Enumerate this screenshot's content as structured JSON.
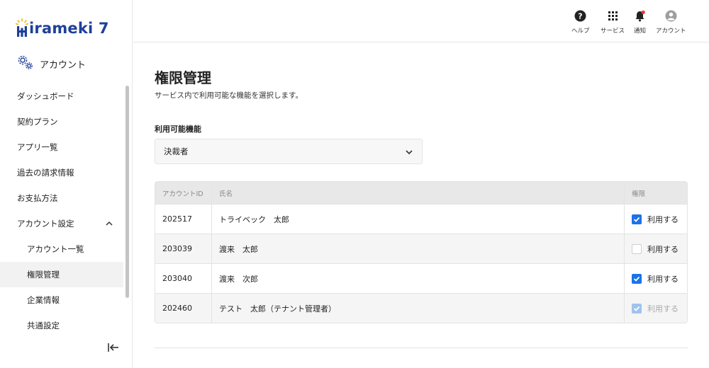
{
  "brand": {
    "logo_text": "irameki 7"
  },
  "sidebar": {
    "section_label": "アカウント",
    "items": [
      {
        "label": "ダッシュボード"
      },
      {
        "label": "契約プラン"
      },
      {
        "label": "アプリ一覧"
      },
      {
        "label": "過去の請求情報"
      },
      {
        "label": "お支払方法"
      },
      {
        "label": "アカウント設定"
      },
      {
        "label": "アカウント一覧"
      },
      {
        "label": "権限管理"
      },
      {
        "label": "企業情報"
      },
      {
        "label": "共通設定"
      }
    ]
  },
  "header": {
    "help_label": "ヘルプ",
    "services_label": "サービス",
    "notifications_label": "通知",
    "account_label": "アカウント"
  },
  "main": {
    "title": "権限管理",
    "description": "サービス内で利用可能な機能を選択します。",
    "feature_label": "利用可能機能",
    "feature_selected": "決裁者",
    "table": {
      "columns": [
        "アカウントID",
        "氏名",
        "権限"
      ],
      "rows": [
        {
          "id": "202517",
          "name": "トライベック　太郎",
          "permission": "利用する",
          "checked": true,
          "disabled": false
        },
        {
          "id": "203039",
          "name": "渡来　太郎",
          "permission": "利用する",
          "checked": false,
          "disabled": false
        },
        {
          "id": "203040",
          "name": "渡来　次郎",
          "permission": "利用する",
          "checked": true,
          "disabled": false
        },
        {
          "id": "202460",
          "name": "テスト　太郎（テナント管理者）",
          "permission": "利用する",
          "checked": true,
          "disabled": true
        }
      ]
    }
  },
  "colors": {
    "brand": "#1f3f99",
    "accent": "#1a73e8",
    "notification_dot": "#e53935",
    "logo_sun": "#f5b800"
  },
  "icons": [
    "help-icon",
    "grid-icon",
    "bell-icon",
    "user-circle-icon",
    "gears-icon",
    "chevron-up-icon",
    "chevron-down-icon",
    "collapse-sidebar-icon",
    "check-icon"
  ]
}
